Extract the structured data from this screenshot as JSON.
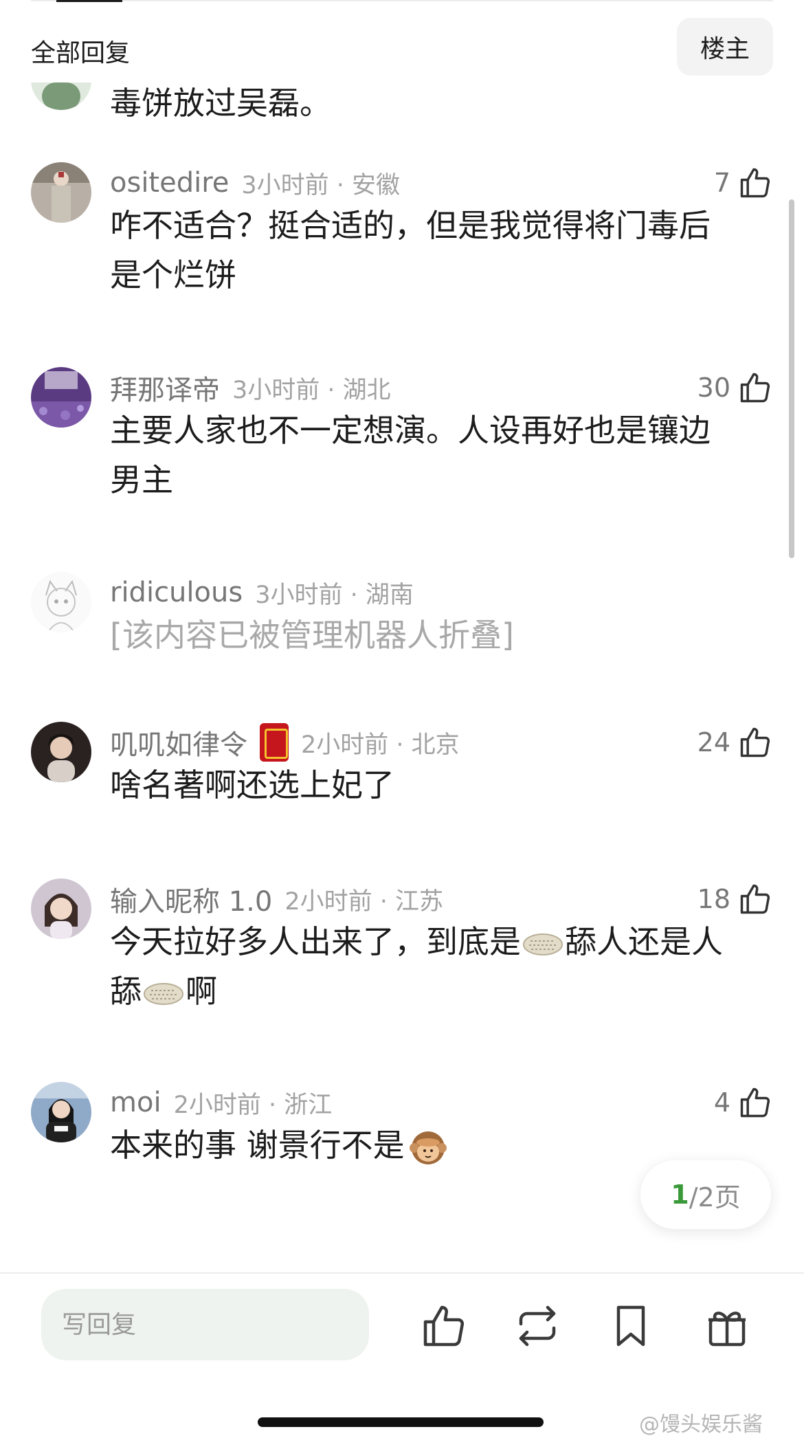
{
  "header": {
    "title": "全部回复",
    "author_button": "楼主"
  },
  "comments": [
    {
      "name": "",
      "text_lines": [
        "毒饼放过吴磊。"
      ],
      "avatar": "green-figure-avatar"
    },
    {
      "name": "ositedire",
      "time_loc": "3小时前 · 安徽",
      "likes": "7",
      "text_lines": [
        "咋不适合？挺合适的，但是我觉得将门毒后",
        "是个烂饼"
      ],
      "avatar": "figure-in-costume-avatar"
    },
    {
      "name": "拜那译帝",
      "time_loc": "3小时前 · 湖北",
      "likes": "30",
      "text_lines": [
        "主要人家也不一定想演。人设再好也是镶边",
        "男主"
      ],
      "avatar": "purple-flowers-avatar"
    },
    {
      "name": "ridiculous",
      "time_loc": "3小时前 · 湖南",
      "text_lines": [
        "[该内容已被管理机器人折叠]"
      ],
      "avatar": "sketch-cat-girl-avatar"
    },
    {
      "name": "叽叽如律令",
      "time_loc": "2小时前 · 北京",
      "likes": "24",
      "text_lines": [
        "啥名著啊还选上妃了"
      ],
      "avatar": "woman-portrait-avatar",
      "badge_icon": "red-envelope-badge-icon"
    },
    {
      "name": "输入昵称 1.0",
      "time_loc": "2小时前 · 江苏",
      "likes": "18",
      "line1_a": "今天拉好多人出来了，到底是",
      "line1_b": "舔人还是人",
      "line2_a": "舔",
      "line2_b": "啊",
      "avatar": "woman-face-avatar",
      "emoji_icon": "flatbread-emoji-icon"
    },
    {
      "name": "moi",
      "time_loc": "2小时前 · 浙江",
      "likes": "4",
      "text": "本来的事 谢景行不是",
      "avatar": "racing-woman-avatar",
      "emoji_icon": "see-no-evil-monkey-emoji-icon"
    }
  ],
  "pager": {
    "current": "1",
    "total": "/2页"
  },
  "bottom_bar": {
    "reply_placeholder": "写回复",
    "actions": [
      "thumbs-up-icon",
      "repost-icon",
      "bookmark-icon",
      "gift-icon"
    ]
  },
  "watermark": "@馒头娱乐酱",
  "colors": {
    "pager_current": "#3a9a3a",
    "reply_bg": "#eef3ef",
    "badge_red": "#c4161c"
  }
}
